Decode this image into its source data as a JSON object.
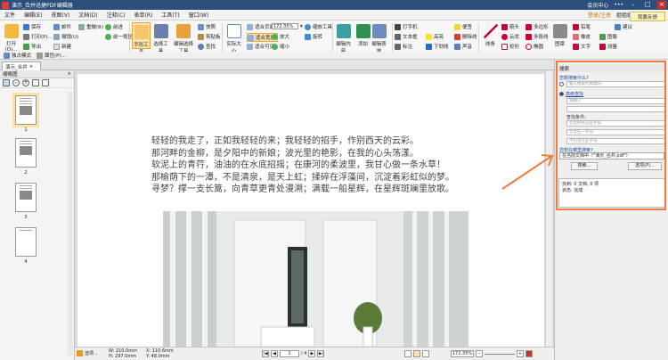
{
  "titlebar": {
    "title": "演示_合并迅捷PDF编辑器",
    "upgrade": "会员中心",
    "dots": "•••",
    "win_min": "–",
    "win_max": "□",
    "win_close": "×"
  },
  "menubar": {
    "items": [
      "文件",
      "编辑(E)",
      "视图(V)",
      "文档(D)",
      "注释(C)",
      "表单(R)",
      "工具(T)",
      "窗口(W)"
    ],
    "login": "登录/注册",
    "account": "姐姐姐",
    "register": "注册",
    "menu": "菜单"
  },
  "ribbon": {
    "open": "打开(O)...",
    "save": "保存",
    "print": "打印(P)...",
    "export": "导出",
    "mail": "邮件",
    "undo": "撤销(U)",
    "redo": "重做(R)",
    "new": "新建",
    "prev_view": "前进",
    "next_view": "前一视图",
    "hand_tool": "手形工具",
    "select_text": "选择工具",
    "edit_select": "编辑选择工具",
    "snapshot": "快照",
    "clipboard": "剪贴板",
    "find": "查找",
    "actual_size": "实际大小",
    "fit_page": "适合页面",
    "fit_width": "适合宽度",
    "fit_visible": "适合可见",
    "zoom": "172.35%",
    "zoom_in": "放大",
    "zoom_out": "缩小",
    "zoom_tool": "缩放工具",
    "rotate": "旋转",
    "edit_content": "编辑内容",
    "add": "添加",
    "form_field": "编辑表单",
    "typewriter": "打字机",
    "textbox": "文本框",
    "callout": "标注",
    "underline": "下划线",
    "sticky": "便签",
    "highlight": "高亮",
    "strikeout": "删除线",
    "sound": "声音",
    "line": "线条",
    "arrow": "箭头",
    "polygon": "多边形",
    "polyline": "多段线",
    "cloud": "云状",
    "pencil": "铅笔",
    "rectangle": "矩形",
    "oval": "椭圆",
    "stamp": "图章",
    "text": "文字",
    "image": "图像",
    "eraser": "橡皮",
    "measure": "测量",
    "feedback": "我要反馈",
    "suggest": "建议",
    "mode": "独占模式",
    "properties": "属性(P)..."
  },
  "tab": {
    "doc_name": "演示_合并",
    "close": "×"
  },
  "thumbnails": {
    "title": "缩略图",
    "close": "×",
    "pages": [
      "1",
      "2",
      "3",
      "4"
    ]
  },
  "document": {
    "poem": [
      "轻轻的我走了，正如我轻轻的来；我轻轻的招手，作别西天的云彩。",
      "那河畔的金柳，是夕阳中的新娘；波光里的艳影，在我的心头荡漾。",
      "软泥上的青荇，油油的在水底招摇；在康河的柔波里，我甘心做一条水草！",
      "那榆荫下的一潭，不是清泉，是天上虹；揉碎在浮藻间，沉淀着彩虹似的梦。",
      "寻梦？撑一支长篙，向青草更青处漫溯；满载一船星辉，在星辉斑斓里放歌。"
    ]
  },
  "statusbar": {
    "options": "选项...",
    "width": "W: 210.0mm",
    "height": "H: 297.0mm",
    "x": "X: 110.6mm",
    "y": "Y: 48.0mm",
    "page": "1",
    "total": "/ 4",
    "zoom": "172.35%"
  },
  "search": {
    "title": "搜索",
    "what_label": "您想搜索什么?",
    "input_placeholder": "输入搜索的关键词...",
    "mode_label": "高级查找",
    "mode_simple": "简单搜索",
    "value": "请输入",
    "conditions_label": "查找条件:",
    "cond1": "包含所有这些字词",
    "cond2": "包含任一字词",
    "cond3": "不包含这些字词",
    "where_label": "您想在哪里搜索?",
    "where_value": "在当前文档中（\"演示_合并.pdf\"）",
    "search_btn": "搜索...",
    "options_btn": "选项(P)...",
    "results_count": "找到: 0 文档, 0 项",
    "results_status": "状态: 完成"
  },
  "colors": {
    "accent": "#f07b3f",
    "titlebar": "#2b4f7c",
    "active_tool": "#fde2a6"
  }
}
